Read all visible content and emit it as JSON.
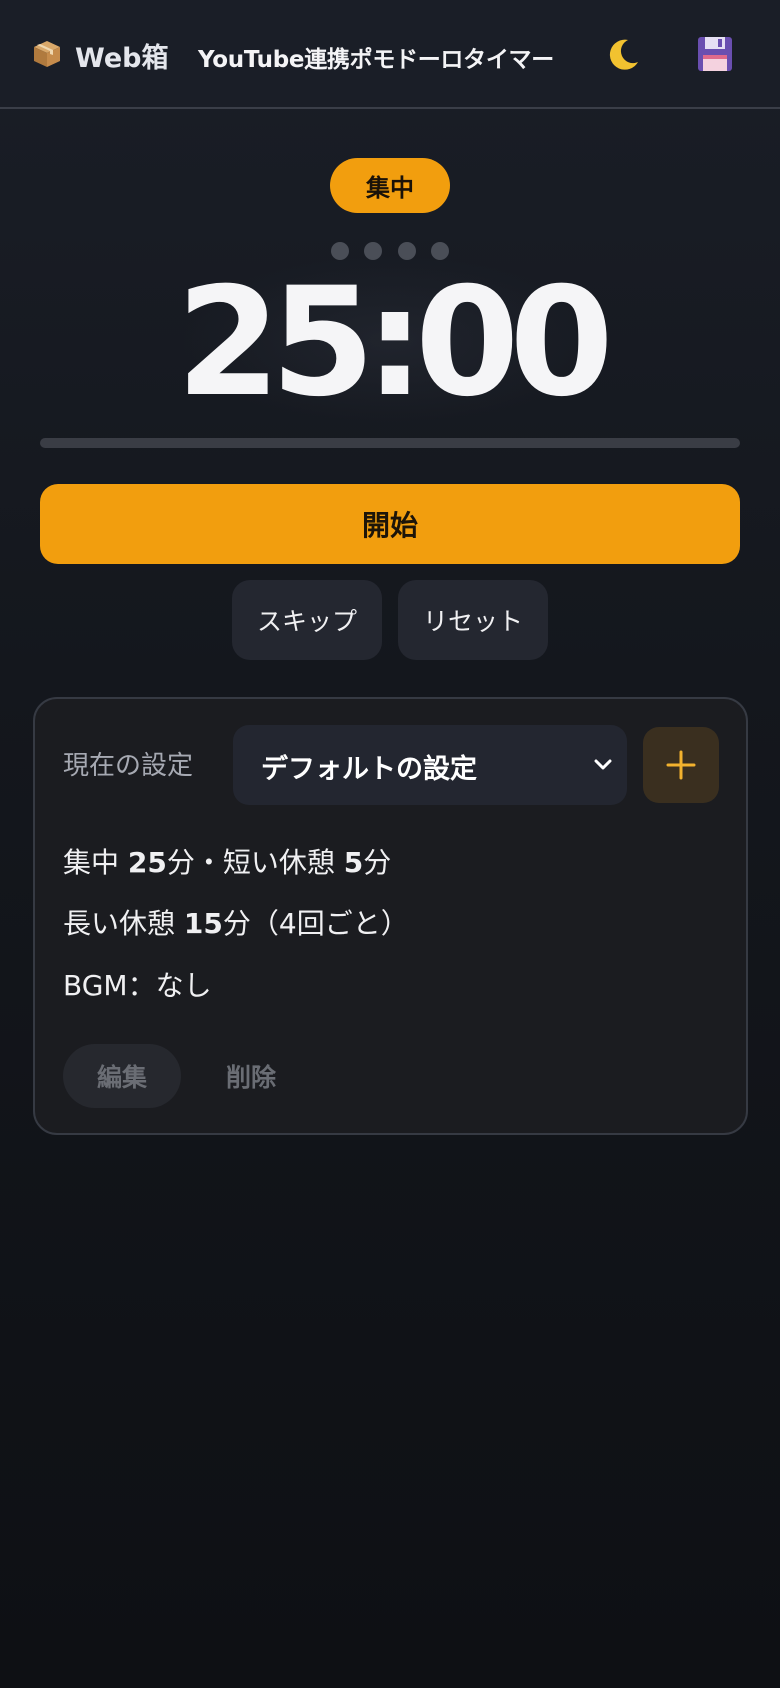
{
  "header": {
    "logo_text": "Web箱",
    "title": "YouTube連携ポモドーロタイマー",
    "icons": [
      "box-icon",
      "moon-icon",
      "floppy-disk-icon"
    ]
  },
  "timer": {
    "phase_label": "集中",
    "display": "25:00",
    "session_dots": 4,
    "progress_fraction": 0
  },
  "controls": {
    "start_label": "開始",
    "skip_label": "スキップ",
    "reset_label": "リセット"
  },
  "settings": {
    "label": "現在の設定",
    "selected_preset": "デフォルトの設定",
    "line1": {
      "focus_label": "集中 ",
      "focus_min": "25",
      "sep": "分・短い休憩 ",
      "short_min": "5",
      "unit": "分"
    },
    "line2": {
      "long_label": "長い休憩 ",
      "long_min": "15",
      "rest": "分（4回ごと）"
    },
    "line3": {
      "bgm": "BGM：なし"
    },
    "edit_label": "編集",
    "delete_label": "削除"
  },
  "colors": {
    "accent": "#f29e0e",
    "background": "#14171d",
    "card": "#1b1c20",
    "muted": "#6a6d74"
  }
}
